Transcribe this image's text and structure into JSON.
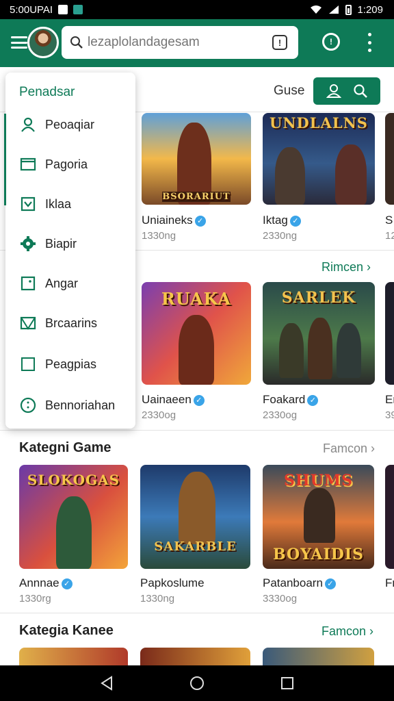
{
  "status_bar": {
    "time_left": "5:00UPAI",
    "time_right": "1:209"
  },
  "app_bar": {
    "search_placeholder": "lezaplolandagesam",
    "menu_icon": "hamburger-icon",
    "alert_glyph": "!",
    "clock_glyph": "!"
  },
  "toolbar": {
    "guide_label": "Guse"
  },
  "drawer": {
    "title": "Penadsar",
    "items": [
      {
        "label": "Peoaqiar",
        "icon": "user-icon"
      },
      {
        "label": "Pagoria",
        "icon": "folder-icon"
      },
      {
        "label": "Iklaa",
        "icon": "checkbox-icon"
      },
      {
        "label": "Biapir",
        "icon": "gear-icon"
      },
      {
        "label": "Angar",
        "icon": "square-dot-icon"
      },
      {
        "label": "Brcaarins",
        "icon": "envelope-icon"
      },
      {
        "label": "Peagpias",
        "icon": "square-icon"
      },
      {
        "label": "Bennoriahan",
        "icon": "info-circle-icon"
      }
    ]
  },
  "row1": {
    "games": [
      {
        "name": "Uniaineks",
        "meta": "1330ng",
        "banner": "BSORARIUT"
      },
      {
        "name": "Iktag",
        "meta": "2330ng",
        "banner": "UNDLALNS"
      },
      {
        "name": "S",
        "meta": "12"
      }
    ]
  },
  "row2": {
    "more": "Rimcen ›",
    "games": [
      {
        "name": "Uainaeen",
        "meta": "2330og",
        "banner": "RUAKA"
      },
      {
        "name": "Foakard",
        "meta": "2330og",
        "banner": "SARLEK"
      },
      {
        "name": "Er",
        "meta": "39"
      }
    ]
  },
  "section3": {
    "title": "Kategni Game",
    "more": "Famcon ›",
    "games": [
      {
        "name": "Annnae",
        "meta": "1330rg",
        "banner": "SLOKOGAS"
      },
      {
        "name": "Papkoslume",
        "meta": "1330ng",
        "banner": "SAKARBLE"
      },
      {
        "name": "Patanboarn",
        "meta": "3330og",
        "banner": "SHUMS",
        "banner2": "BOYAIDIS"
      },
      {
        "name": "Fr",
        "meta": ""
      }
    ]
  },
  "section4": {
    "title": "Kategia Kanee",
    "more": "Famcon ›"
  },
  "colors": {
    "brand_green": "#0e7a57",
    "verified_blue": "#3aa4e8"
  }
}
